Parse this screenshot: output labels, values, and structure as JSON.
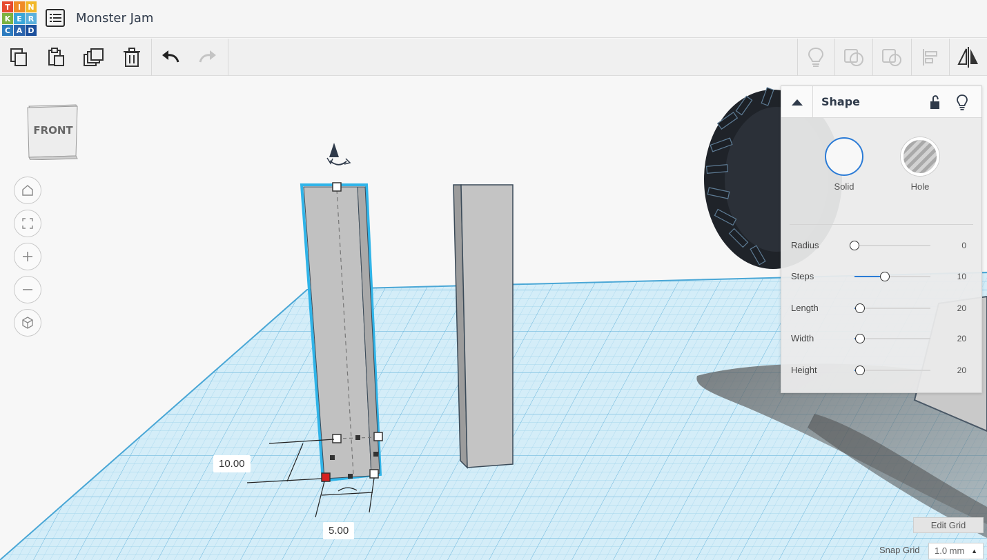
{
  "header": {
    "logo_letters": [
      "T",
      "I",
      "N",
      "K",
      "E",
      "R",
      "C",
      "A",
      "D"
    ],
    "logo_colors": [
      "#e64a2e",
      "#f08b26",
      "#f2b829",
      "#7bb241",
      "#3aa6d8",
      "#5bb0dc",
      "#2c7bbf",
      "#2a64ad",
      "#1b4f9c"
    ],
    "project_title": "Monster Jam"
  },
  "toolbar": {
    "left_icons": [
      "copy-icon",
      "paste-icon",
      "duplicate-icon",
      "delete-icon",
      "undo-icon",
      "redo-icon"
    ],
    "right_icons": [
      "notes-icon",
      "group-icon",
      "ungroup-icon",
      "align-icon",
      "mirror-icon"
    ]
  },
  "viewcube": {
    "face_label": "FRONT"
  },
  "nav": [
    "home-view-icon",
    "fit-view-icon",
    "zoom-in-icon",
    "zoom-out-icon",
    "perspective-icon"
  ],
  "inspector": {
    "title": "Shape",
    "solid_label": "Solid",
    "hole_label": "Hole",
    "properties": [
      {
        "name": "Radius",
        "value": "0",
        "level": 0.0
      },
      {
        "name": "Steps",
        "value": "10",
        "level": 0.4
      },
      {
        "name": "Length",
        "value": "20",
        "level": 0.07
      },
      {
        "name": "Width",
        "value": "20",
        "level": 0.07
      },
      {
        "name": "Height",
        "value": "20",
        "level": 0.07
      }
    ]
  },
  "dimensions": {
    "height_label": "10.00",
    "width_label": "5.00"
  },
  "grid": {
    "edit_label": "Edit Grid",
    "snap_label": "Snap Grid",
    "snap_value": "1.0 mm"
  },
  "colors": {
    "grid_blue": "#b9e2f3",
    "selection": "#30b4e8",
    "accent": "#2b7bd6"
  }
}
